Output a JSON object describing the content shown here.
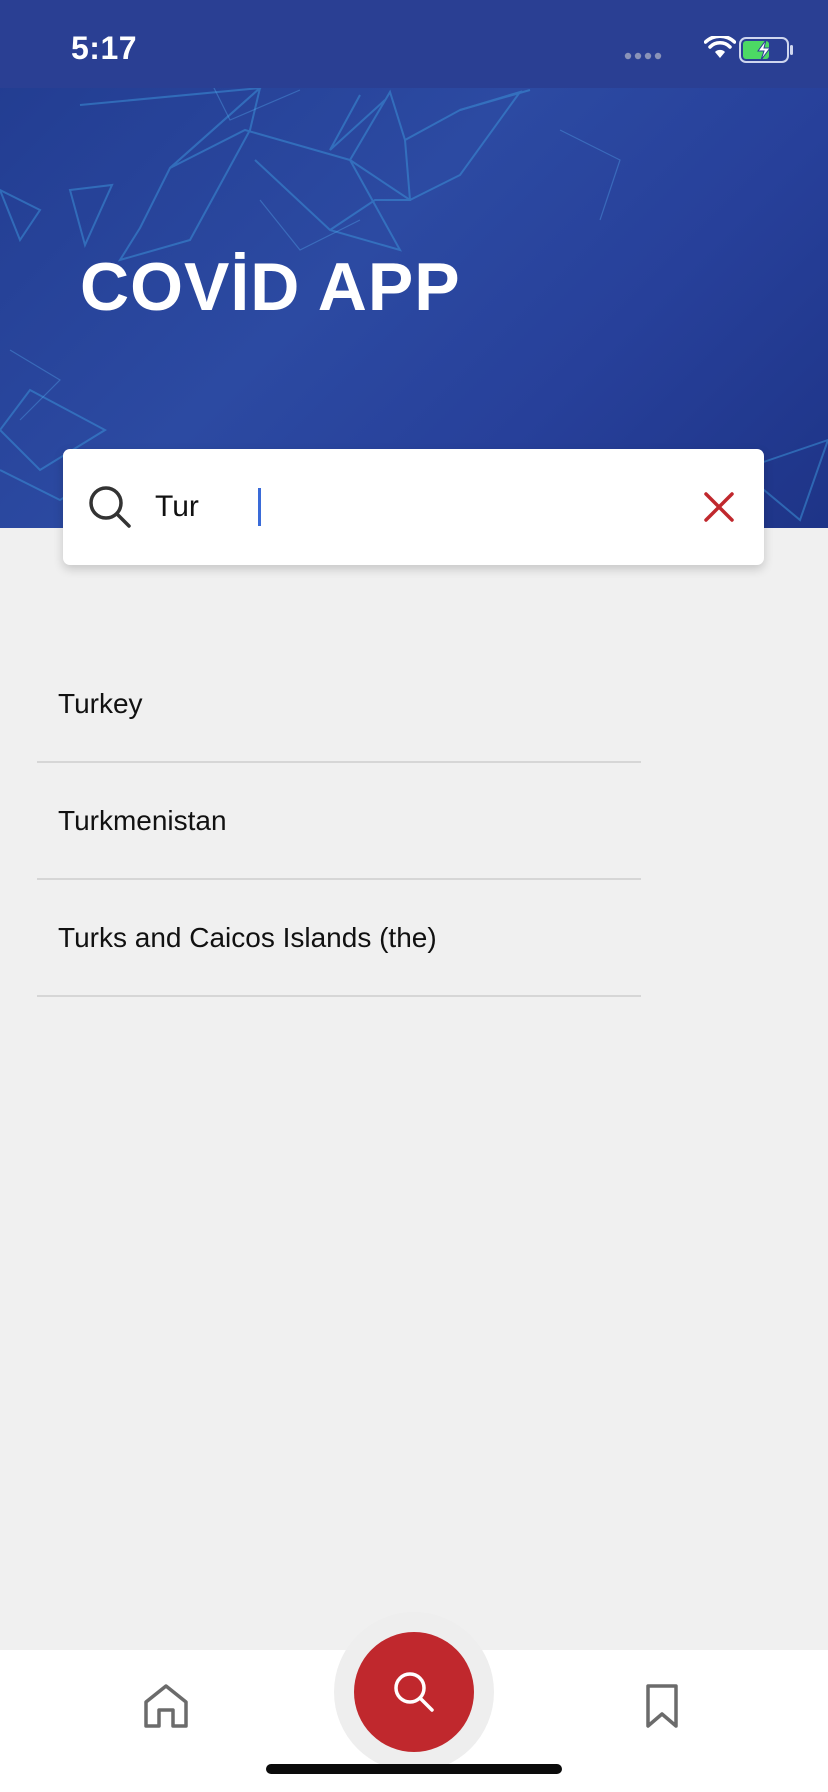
{
  "status_bar": {
    "time": "5:17",
    "signal_icon": "signal-dots-icon",
    "wifi_icon": "wifi-icon",
    "battery_icon": "battery-charging-icon"
  },
  "header": {
    "title": "COVİD APP",
    "background_color": "#2a3f93"
  },
  "search": {
    "value": "Tur",
    "icon": "search-icon",
    "clear_icon": "close-icon",
    "clear_color": "#c0282d"
  },
  "results": [
    {
      "label": "Turkey"
    },
    {
      "label": "Turkmenistan"
    },
    {
      "label": "Turks and Caicos Islands (the)"
    }
  ],
  "tab_bar": {
    "items": [
      "home-icon",
      "search-icon",
      "bookmark-icon"
    ],
    "active": "search",
    "active_color": "#c0282d"
  }
}
